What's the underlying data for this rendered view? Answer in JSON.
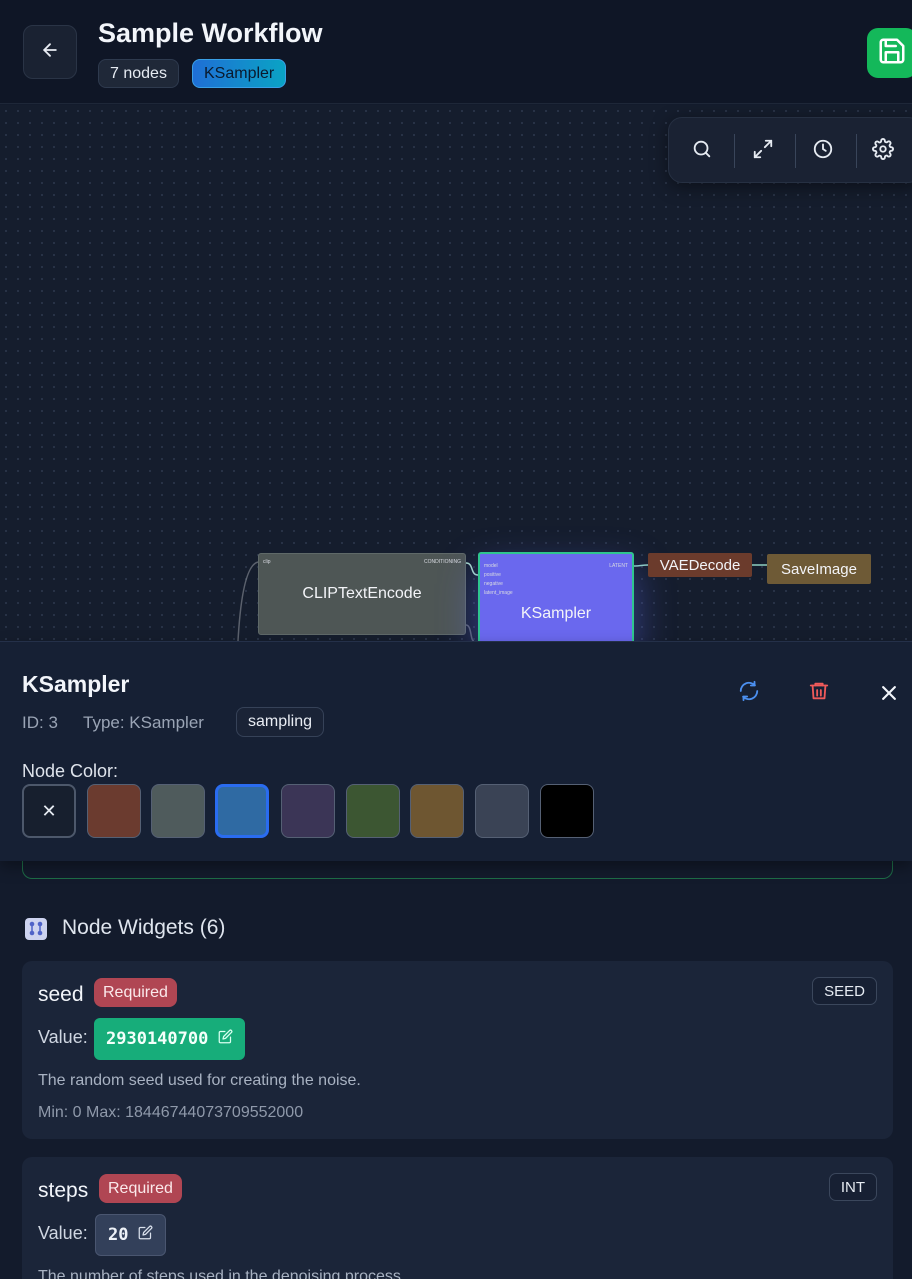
{
  "header": {
    "title": "Sample Workflow",
    "node_count": "7 nodes",
    "selected_type_chip": "KSampler"
  },
  "canvas": {
    "nodes": {
      "clip": {
        "label": "CLIPTextEncode",
        "input": "clip",
        "output": "CONDITIONING"
      },
      "ksampler": {
        "label": "KSampler",
        "inputs": [
          "model",
          "positive",
          "negative",
          "latent_image"
        ],
        "output": "LATENT"
      },
      "vae": {
        "label": "VAEDecode"
      },
      "save": {
        "label": "SaveImage"
      }
    },
    "colors": {
      "clip": "#4e5655",
      "ksampler": "#6a68ee",
      "vae": "#6b3b2c",
      "save": "#6e5a36"
    }
  },
  "panel": {
    "title": "KSampler",
    "id_text": "ID: 3",
    "type_text": "Type: KSampler",
    "category": "sampling",
    "node_color_label": "Node Color:",
    "swatches": [
      "none",
      "#6b3b2f",
      "#4f5b5c",
      "#2f6aa3",
      "#3b3556",
      "#3c5632",
      "#6e5631",
      "#3a4355",
      "#000000"
    ],
    "selected_swatch": "#2f6aa3"
  },
  "widgets": {
    "section_title": "Node Widgets (6)",
    "items": [
      {
        "name": "seed",
        "required": "Required",
        "type": "SEED",
        "value_label": "Value:",
        "value": "2930140700",
        "description": "The random seed used for creating the noise.",
        "minmax": "Min: 0 Max: 18446744073709552000"
      },
      {
        "name": "steps",
        "required": "Required",
        "type": "INT",
        "value_label": "Value:",
        "value": "20",
        "description": "The number of steps used in the denoising process."
      }
    ]
  }
}
